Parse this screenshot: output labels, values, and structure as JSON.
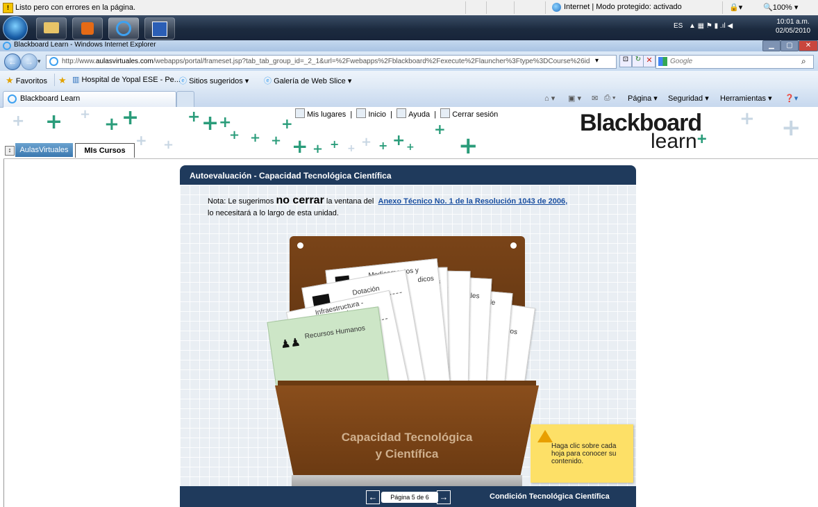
{
  "statusbar": {
    "message": "Listo pero con errores en la página.",
    "zone": "Internet | Modo protegido: activado",
    "zoom": "100%"
  },
  "taskbar": {
    "language": "ES",
    "time": "10:01 a.m.",
    "date": "02/05/2010"
  },
  "window": {
    "title": "Blackboard Learn - Windows Internet Explorer"
  },
  "address": {
    "url_prefix": "http://www.",
    "url_domain": "aulasvirtuales.com",
    "url_rest": "/webapps/portal/frameset.jsp?tab_tab_group_id=_2_1&url=%2Fwebapps%2Fblackboard%2Fexecute%2Flauncher%3Ftype%3DCourse%26id%3D_1",
    "search_placeholder": "Google"
  },
  "favorites": {
    "label": "Favoritos",
    "items": [
      "Hospital de Yopal ESE - Pe...",
      "Sitios sugeridos ▾",
      "Galería de Web Slice ▾"
    ]
  },
  "tabs": {
    "active_tab": "Blackboard Learn"
  },
  "commandbar": {
    "page": "Página ▾",
    "security": "Seguridad ▾",
    "tools": "Herramientas ▾"
  },
  "bb": {
    "nav": [
      "Mis lugares",
      "Inicio",
      "Ayuda",
      "Cerrar sesión"
    ],
    "logo_top": "Blackboard",
    "logo_bottom": "learn",
    "tab_aulas": "AulasVirtuales",
    "tab_cursos": "MIs Cursos"
  },
  "lo": {
    "header": "Autoevaluación - Capacidad Tecnológica Científica",
    "note_pre": "Nota: Le sugerimos ",
    "note_big": "no cerrar",
    "note_mid": " la ventana del ",
    "note_link": "Anexo Técnico No. 1 de la Resolución 1043 de 2006,",
    "note_post": "lo necesitará a lo largo de esta unidad.",
    "sheets": {
      "medicamentos": "Medicamentos y",
      "medicamentos2": "dicos",
      "dotacion": "Dotación",
      "infra1": "Infraestructura -",
      "infra2": "sicas -",
      "infra3": "nto",
      "rrhh": "Recursos Humanos",
      "s1": "tarios",
      "s2": "s",
      "s3": "y",
      "s4": "ales",
      "s5": "de",
      "s6": "gos"
    },
    "basket_line1": "Capacidad Tecnológica",
    "basket_line2": "y Científica",
    "sticky": "Haga clic sobre cada hoja para conocer su contenido.",
    "page_indicator": "Página 5 de 6",
    "footer_title": "Condición Tecnológica Científica"
  },
  "colors": {
    "header_navy": "#1f3a5c",
    "folder_brown": "#6b3a12",
    "sticky_yellow": "#fde067",
    "bb_green": "#2a9c7a"
  }
}
